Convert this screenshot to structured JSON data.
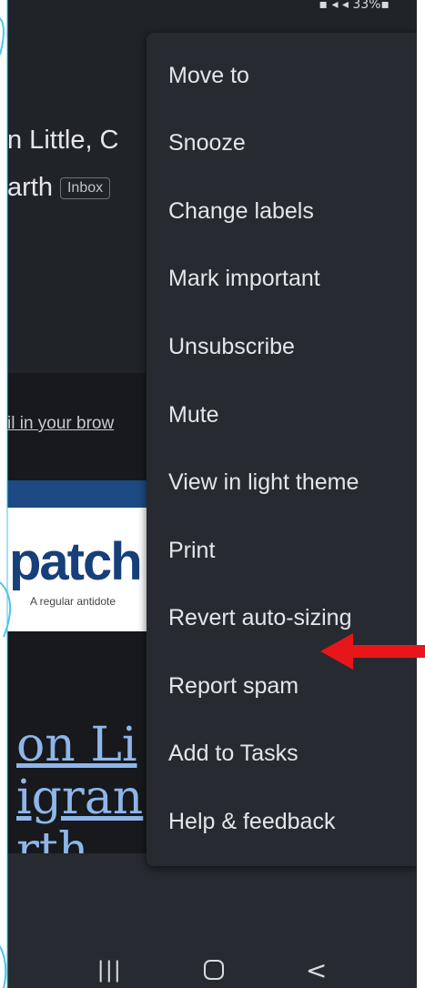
{
  "status_bar": {
    "icons": "▪ ◂ ◂ 33%▪"
  },
  "email": {
    "sender_fragment": "n Little, C",
    "subject_fragment": "arth",
    "label_chip": "Inbox",
    "browser_link": "il in your brow",
    "banner_logo": "patch",
    "banner_tagline": "A regular antidote",
    "title_line1": "on Li",
    "title_line2": "igran",
    "title_line3": "rth"
  },
  "menu": {
    "items": [
      "Move to",
      "Snooze",
      "Change labels",
      "Mark important",
      "Unsubscribe",
      "Mute",
      "View in light theme",
      "Print",
      "Revert auto-sizing",
      "Report spam",
      "Add to Tasks",
      "Help & feedback"
    ]
  },
  "annotation": {
    "arrow_color": "#e8151b",
    "points_to": "Revert auto-sizing"
  },
  "nav_bar": {
    "recents": "|||",
    "back": "<"
  },
  "colors": {
    "accent_cyan": "#4fc3e8",
    "menu_bg": "#272b31"
  }
}
